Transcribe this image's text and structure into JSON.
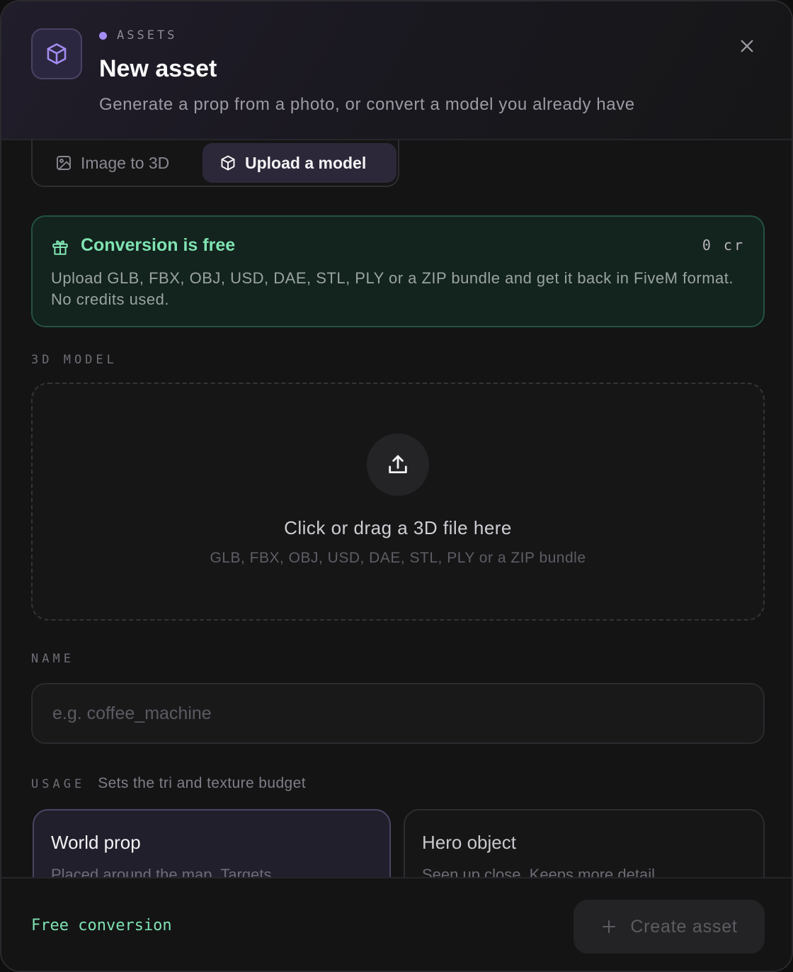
{
  "header": {
    "eyebrow": "ASSETS",
    "title": "New asset",
    "subtitle": "Generate a prop from a photo, or convert a model you already have",
    "icon": "cube-icon",
    "close_icon": "close-icon"
  },
  "tabs": [
    {
      "label": "Image to 3D",
      "icon": "image-icon",
      "active": false
    },
    {
      "label": "Upload a model",
      "icon": "cube-icon",
      "active": true
    }
  ],
  "banner": {
    "title": "Conversion is free",
    "cost": "0 cr",
    "body": "Upload GLB, FBX, OBJ, USD, DAE, STL, PLY or a ZIP bundle and get it back in FiveM format. No credits used.",
    "icon": "gift-icon"
  },
  "model_section": {
    "label": "3D MODEL",
    "drop_title": "Click or drag a 3D file here",
    "drop_subtitle": "GLB, FBX, OBJ, USD, DAE, STL, PLY or a ZIP bundle",
    "icon": "upload-icon"
  },
  "name_section": {
    "label": "NAME",
    "value": "",
    "placeholder": "e.g. coffee_machine"
  },
  "usage_section": {
    "label": "USAGE",
    "hint": "Sets the tri and texture budget",
    "options": [
      {
        "title": "World prop",
        "description": "Placed around the map. Targets",
        "selected": true
      },
      {
        "title": "Hero object",
        "description": "Seen up close. Keeps more detail",
        "selected": false
      }
    ]
  },
  "footer": {
    "note": "Free conversion",
    "create_label": "Create asset",
    "create_icon": "plus-icon"
  },
  "colors": {
    "accent": "#a48cf2",
    "success": "#7fe3b3",
    "background": "#141415"
  }
}
